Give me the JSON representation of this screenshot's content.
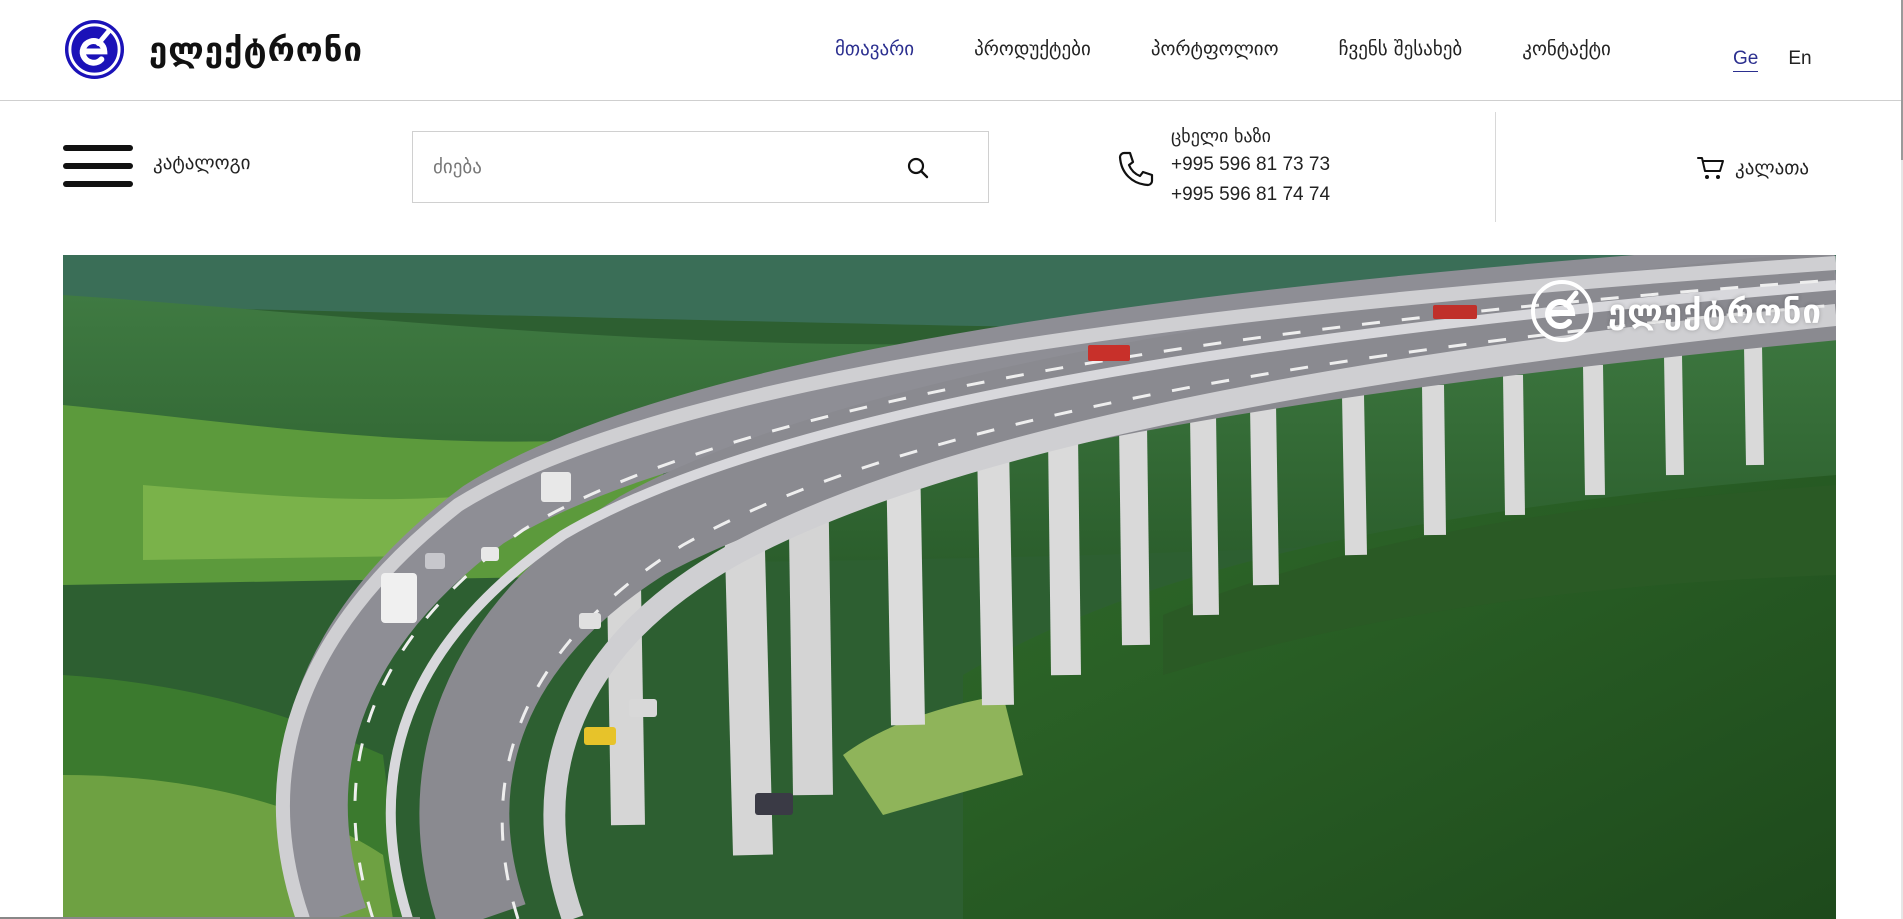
{
  "brand": {
    "name": "ელექტრონი",
    "color": "#1b12b8"
  },
  "nav": {
    "items": [
      {
        "label": "მთავარი",
        "active": true
      },
      {
        "label": "პროდუქტები",
        "active": false
      },
      {
        "label": "პორტფოლიო",
        "active": false
      },
      {
        "label": "ჩვენს შესახებ",
        "active": false
      },
      {
        "label": "კონტაქტი",
        "active": false
      }
    ],
    "active_color": "#2b2f8f"
  },
  "languages": {
    "current": "Ge",
    "other": "En"
  },
  "catalog": {
    "label": "კატალოგი"
  },
  "search": {
    "placeholder": "ძიება",
    "value": ""
  },
  "hotline": {
    "title": "ცხელი ხაზი",
    "phone_1": "+995 596 81 73 73",
    "phone_2": "+995 596 81 74 74"
  },
  "cart": {
    "label": "კალათა"
  },
  "hero": {
    "watermark_text": "ელექტრონი"
  },
  "icons": {
    "menu": "hamburger-icon",
    "search": "search-icon",
    "phone": "phone-icon",
    "cart": "cart-icon"
  }
}
